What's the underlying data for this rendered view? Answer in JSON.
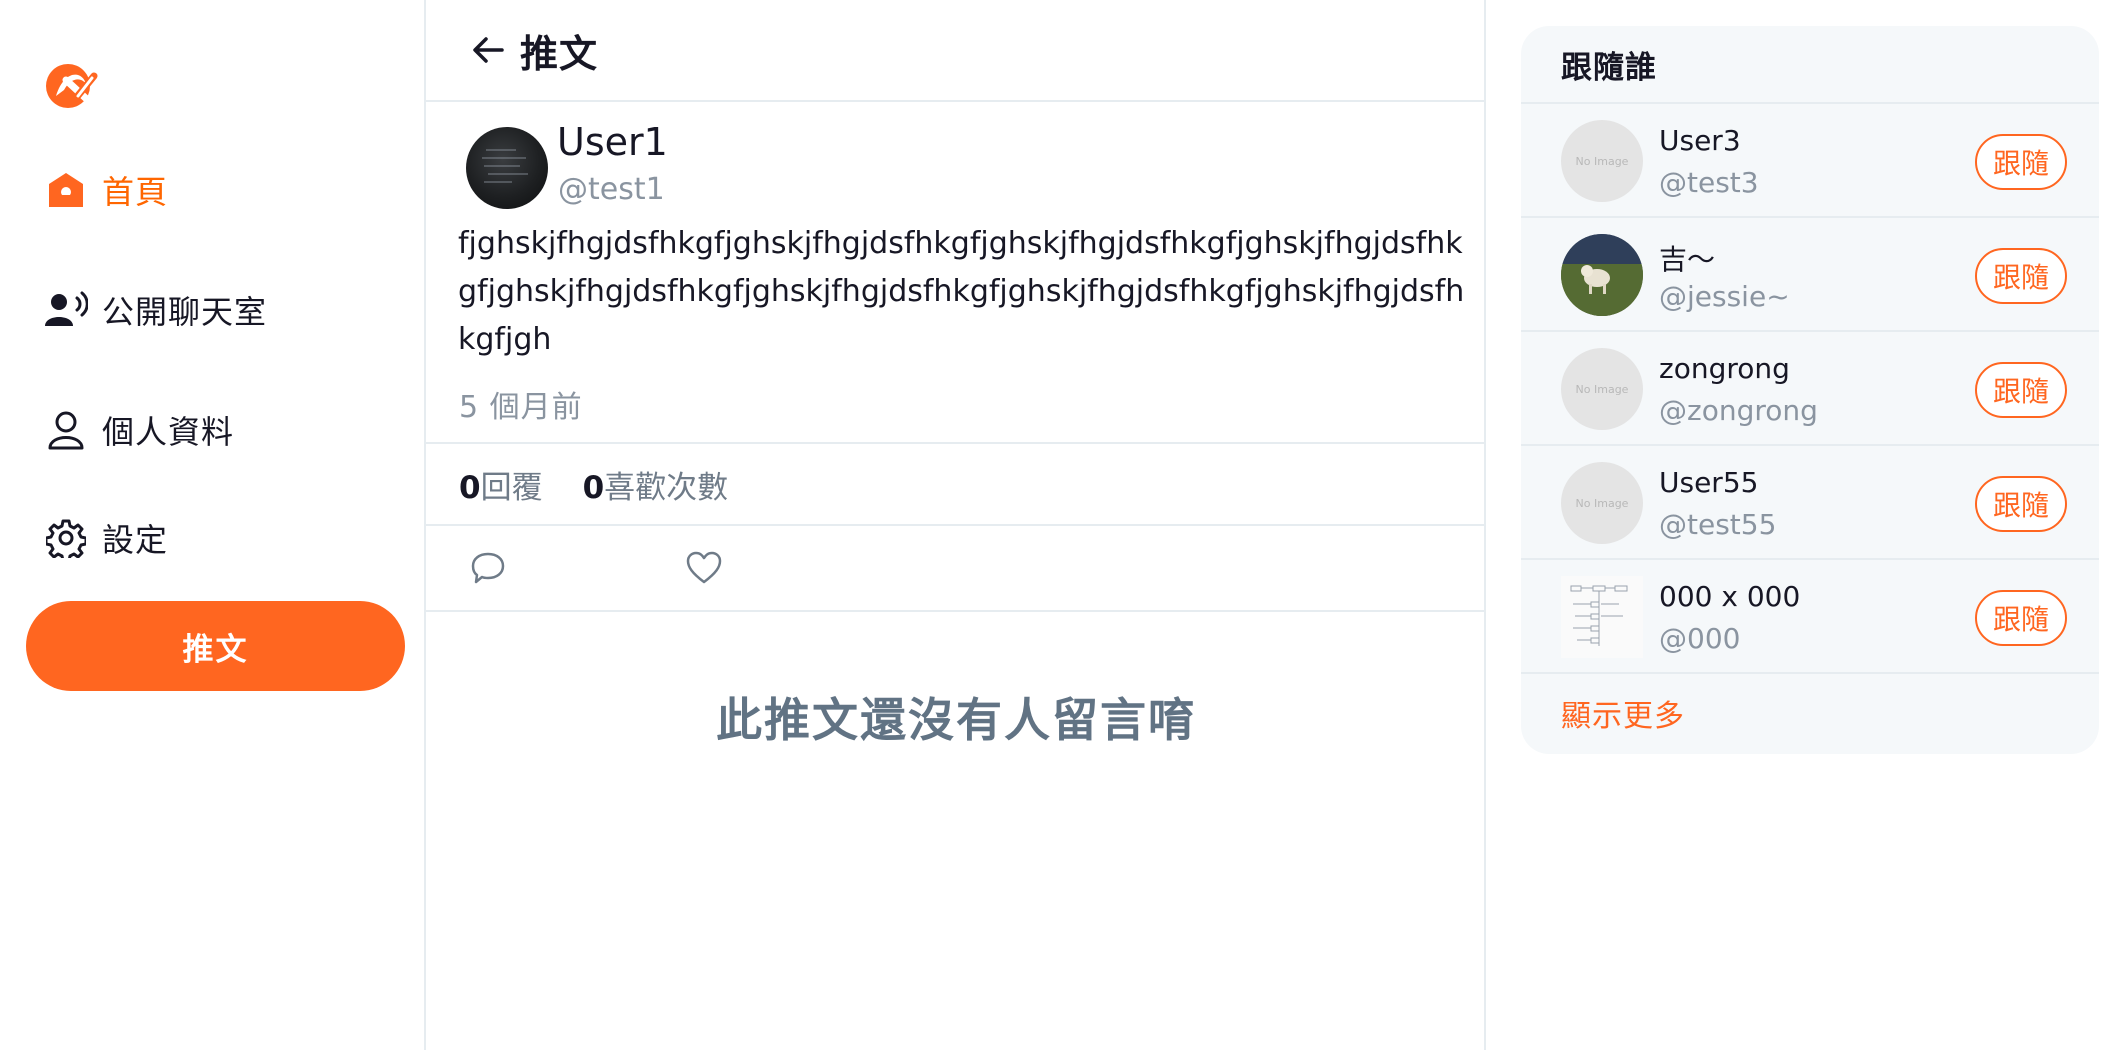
{
  "sidebar": {
    "logo": "alpha-camp-logo",
    "items": [
      {
        "label": "首頁",
        "icon": "home-icon",
        "active": true
      },
      {
        "label": "公開聊天室",
        "icon": "user-voice-icon",
        "active": false
      },
      {
        "label": "個人資料",
        "icon": "user-icon",
        "active": false
      },
      {
        "label": "設定",
        "icon": "gear-icon",
        "active": false
      }
    ],
    "tweet_button": "推文"
  },
  "main": {
    "header": {
      "back_icon": "arrow-left-icon",
      "title": "推文"
    },
    "tweet": {
      "name": "User1",
      "handle": "@test1",
      "body": "fjghskjfhgjdsfhkgfjghskjfhgjdsfhkgfjghskjfhgjdsfhkgfjghskjfhgjdsfhkgfjghskjfhgjdsfhkgfjghskjfhgjdsfhkgfjghskjfhgjdsfhkgfjghskjfhgjdsfhkgfjgh",
      "time": "5 個月前"
    },
    "stats": {
      "replies_count": "0",
      "replies_label": "回覆",
      "likes_count": "0",
      "likes_label": "喜歡次數"
    },
    "actions": {
      "reply_icon": "comment-icon",
      "like_icon": "heart-icon"
    },
    "empty_message": "此推文還沒有人留言唷"
  },
  "follow_panel": {
    "title": "跟隨誰",
    "users": [
      {
        "name": "User3",
        "handle": "@test3",
        "button": "跟隨",
        "avatar": "No Image"
      },
      {
        "name": "吉～",
        "handle": "@jessie~",
        "button": "跟隨",
        "avatar": "photo"
      },
      {
        "name": "zongrong",
        "handle": "@zongrong",
        "button": "跟隨",
        "avatar": "No Image"
      },
      {
        "name": "User55",
        "handle": "@test55",
        "button": "跟隨",
        "avatar": "No Image"
      },
      {
        "name": "000 x 000",
        "handle": "@000",
        "button": "跟隨",
        "avatar": "diagram"
      }
    ],
    "show_more": "顯示更多"
  },
  "colors": {
    "accent": "#ff6620",
    "muted_text": "#8a94a0",
    "panel_bg": "#f5f8fa",
    "border": "#e6ecf0"
  }
}
